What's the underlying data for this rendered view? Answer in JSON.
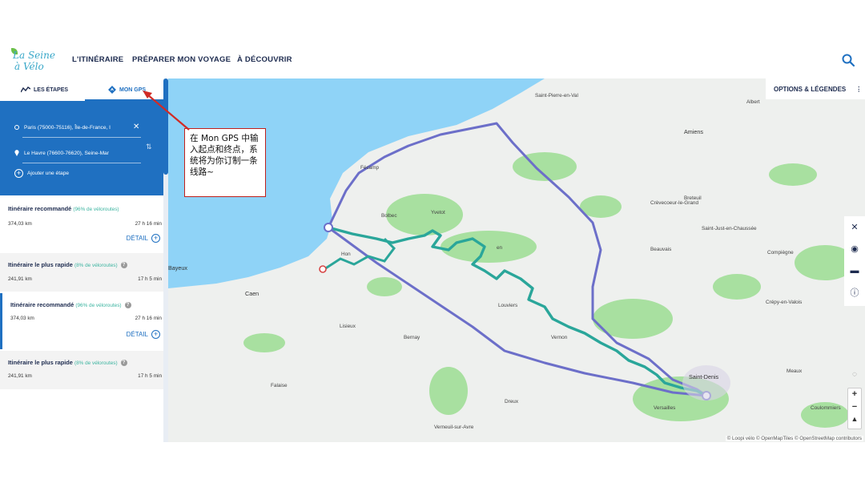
{
  "header": {
    "logo_line1": "La Seine",
    "logo_line2": "à Vélo",
    "nav": [
      "L'ITINÉRAIRE",
      "PRÉPARER MON VOYAGE",
      "À DÉCOUVRIR"
    ],
    "search_icon": "search-icon"
  },
  "sidebar": {
    "tabs": [
      {
        "label": "LES ÉTAPES",
        "icon": "route-icon"
      },
      {
        "label": "MON GPS",
        "icon": "gps-diamond-icon"
      }
    ],
    "gps": {
      "from": "Paris (75000-75116), Île-de-France, I",
      "to": "Le Havre (76600-76620), Seine-Mar",
      "add_step": "Ajouter une étape"
    },
    "routes": [
      {
        "title": "Itinéraire recommandé",
        "pct": "(96% de véloroutes)",
        "distance": "374,03 km",
        "time": "27 h 16 min",
        "detail": "DÉTAIL"
      },
      {
        "title": "Itinéraire le plus rapide",
        "pct": "(8% de véloroutes)",
        "distance": "241,91 km",
        "time": "17 h 5 min"
      },
      {
        "title": "Itinéraire recommandé",
        "pct": "(96% de véloroutes)",
        "distance": "374,03 km",
        "time": "27 h 16 min",
        "detail": "DÉTAIL"
      },
      {
        "title": "Itinéraire le plus rapide",
        "pct": "(8% de véloroutes)",
        "distance": "241,91 km",
        "time": "17 h 5 min"
      }
    ]
  },
  "map": {
    "options_label": "OPTIONS & LÉGENDES",
    "attribution": "© Loopi vélo © OpenMapTiles © OpenStreetMap contributors",
    "labels": {
      "saint_pierre": "Saint-Pierre-en-Val",
      "albert": "Albert",
      "amiens": "Amiens",
      "fecamp": "Fécamp",
      "yvetot": "Yvetot",
      "bolbec": "Bolbec",
      "crevecoeur": "Crèvecoeur-le-Grand",
      "breteuil": "Breteuil",
      "saint_just": "Saint-Just-en-Chaussée",
      "compiegne": "Compiègne",
      "beauvais": "Beauvais",
      "bayeux": "Bayeux",
      "caen": "Caen",
      "lisieux": "Lisieux",
      "bernay": "Bernay",
      "louviers": "Louviers",
      "vernon": "Vernon",
      "crepy": "Crépy-en-Valois",
      "meaux": "Meaux",
      "saint_denis": "Saint-Denis",
      "versailles": "Versailles",
      "coulommiers": "Coulommiers",
      "dreux": "Dreux",
      "falaise": "Falaise",
      "verneuil": "Verneuil-sur-Avre",
      "rouen": "en",
      "honfleur": "Hon"
    },
    "colors": {
      "sea": "#8fd3f7",
      "land": "#eef0ee",
      "forest": "#a8e0a0",
      "route_recommended": "#2aa69a",
      "route_fast": "#6c6fc9"
    }
  },
  "annotation": {
    "text": "在 Mon GPS 中输入起点和终点，系统将为你订制一条线路~"
  }
}
